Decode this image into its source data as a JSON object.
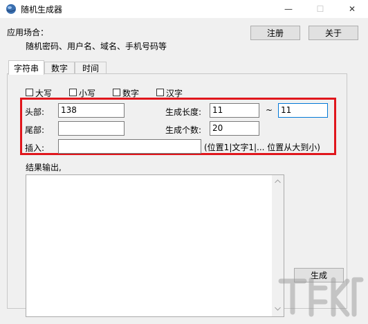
{
  "window": {
    "title": "随机生成器",
    "minimize_glyph": "—",
    "maximize_glyph": "☐",
    "close_glyph": "✕"
  },
  "header": {
    "usage_title": "应用场合：",
    "usage_text": "随机密码、用户名、域名、手机号码等",
    "register_label": "注册",
    "about_label": "关于"
  },
  "tabs": [
    {
      "label": "字符串",
      "active": true
    },
    {
      "label": "数字",
      "active": false
    },
    {
      "label": "时间",
      "active": false
    }
  ],
  "options": [
    {
      "label": "大写",
      "checked": false
    },
    {
      "label": "小写",
      "checked": false
    },
    {
      "label": "数字",
      "checked": false
    },
    {
      "label": "汉字",
      "checked": false
    }
  ],
  "form": {
    "head_label": "头部:",
    "head_value": "138",
    "tail_label": "尾部:",
    "tail_value": "",
    "insert_label": "插入:",
    "insert_value": "",
    "insert_hint": "(位置1|文字1|... 位置从大到小)",
    "length_label": "生成长度:",
    "length_min": "11",
    "length_sep": "~",
    "length_max": "11",
    "count_label": "生成个数:",
    "count_value": "20"
  },
  "output": {
    "label": "结果输出,",
    "generate_label": "生成"
  },
  "colors": {
    "highlight_border": "#e0161c",
    "focus_border": "#0078d7"
  },
  "icons": {
    "app": "app-globe-icon",
    "watermark": "download-site-watermark-icon"
  }
}
